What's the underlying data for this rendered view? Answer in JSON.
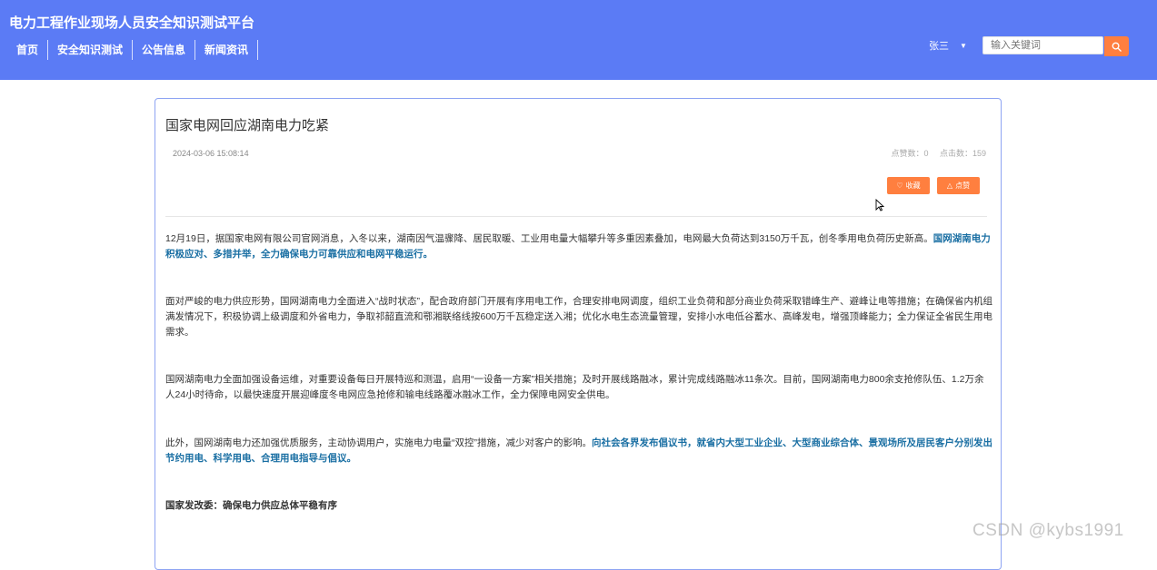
{
  "header": {
    "site_title": "电力工程作业现场人员安全知识测试平台",
    "nav": [
      "首页",
      "安全知识测试",
      "公告信息",
      "新闻资讯"
    ],
    "user_name": "张三",
    "search_placeholder": "输入关键词",
    "accent_color": "#5b7bf5",
    "button_color": "#ff7f3f"
  },
  "article": {
    "title": "国家电网回应湖南电力吃紧",
    "date": "2024-03-06 15:08:14",
    "likes_label": "点赞数：0",
    "clicks_label": "点击数：159",
    "favorite_label": "收藏",
    "like_label": "点赞",
    "p1_text": "12月19日，据国家电网有限公司官网消息，入冬以来，湖南因气温骤降、居民取暖、工业用电量大幅攀升等多重因素叠加，电网最大负荷达到3150万千瓦，创冬季用电负荷历史新高。",
    "p1_highlight": "国网湖南电力积极应对、多措并举，全力确保电力可靠供应和电网平稳运行。",
    "p2_text": "面对严峻的电力供应形势，国网湖南电力全面进入“战时状态”，配合政府部门开展有序用电工作，合理安排电网调度，组织工业负荷和部分商业负荷采取错峰生产、避峰让电等措施；在确保省内机组满发情况下，积极协调上级调度和外省电力，争取祁韶直流和鄂湘联络线按600万千瓦稳定送入湘；优化水电生态流量管理，安排小水电低谷蓄水、高峰发电，增强顶峰能力；全力保证全省民生用电需求。",
    "p3_text": "国网湖南电力全面加强设备运维，对重要设备每日开展特巡和测温，启用“一设备一方案”相关措施；及时开展线路融冰，累计完成线路融冰11条次。目前，国网湖南电力800余支抢修队伍、1.2万余人24小时待命，以最快速度开展迎峰度冬电网应急抢修和输电线路覆冰融冰工作，全力保障电网安全供电。",
    "p4_text": "此外，国网湖南电力还加强优质服务，主动协调用户，实施电力电量“双控”措施，减少对客户的影响。",
    "p4_highlight": "向社会各界发布倡议书，就省内大型工业企业、大型商业综合体、景观场所及居民客户分别发出节约用电、科学用电、合理用电指导与倡议。",
    "p5_text": "国家发改委：确保电力供应总体平稳有序"
  },
  "watermark": "CSDN @kybs1991"
}
